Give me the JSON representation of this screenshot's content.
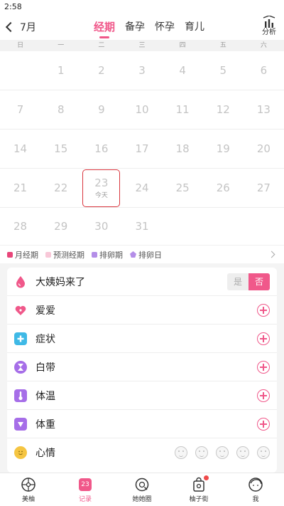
{
  "status_bar": {
    "time": "2:58"
  },
  "header": {
    "back_label": "7月",
    "tabs": [
      {
        "label": "经期",
        "active": true
      },
      {
        "label": "备孕",
        "active": false
      },
      {
        "label": "怀孕",
        "active": false
      },
      {
        "label": "育儿",
        "active": false
      }
    ],
    "analysis_label": "分析"
  },
  "calendar": {
    "weekdays": [
      "日",
      "一",
      "二",
      "三",
      "四",
      "五",
      "六"
    ],
    "rows": [
      [
        "",
        "1",
        "2",
        "3",
        "4",
        "5",
        "6"
      ],
      [
        "7",
        "8",
        "9",
        "10",
        "11",
        "12",
        "13"
      ],
      [
        "14",
        "15",
        "16",
        "17",
        "18",
        "19",
        "20"
      ],
      [
        "21",
        "22",
        "23",
        "24",
        "25",
        "26",
        "27"
      ],
      [
        "28",
        "29",
        "30",
        "31",
        "",
        "",
        ""
      ]
    ],
    "today_label": "今天"
  },
  "legend": {
    "items": [
      {
        "label": "月经期",
        "color": "#e8467a"
      },
      {
        "label": "预测经期",
        "color": "#f8c8d8"
      },
      {
        "label": "排卵期",
        "color": "#b48ee8"
      },
      {
        "label": "排卵日",
        "color": "#b48ee8"
      }
    ]
  },
  "record": {
    "period": {
      "label": "大姨妈来了",
      "yes_label": "是",
      "no_label": "否",
      "selected": "否"
    },
    "items": [
      {
        "label": "爱爱",
        "icon": "heart-icon",
        "color": "#f0588a"
      },
      {
        "label": "症状",
        "icon": "medkit-icon",
        "color": "#3fb9e6"
      },
      {
        "label": "白带",
        "icon": "hourglass-icon",
        "color": "#a66ee8"
      },
      {
        "label": "体温",
        "icon": "thermometer-icon",
        "color": "#a66ee8"
      },
      {
        "label": "体重",
        "icon": "scale-icon",
        "color": "#a66ee8"
      }
    ],
    "mood": {
      "label": "心情"
    }
  },
  "bottom_nav": {
    "items": [
      {
        "label": "美柚"
      },
      {
        "label": "记录",
        "badge": "23"
      },
      {
        "label": "她她圈"
      },
      {
        "label": "柚子街"
      },
      {
        "label": "我"
      }
    ]
  },
  "colors": {
    "accent": "#f0588a",
    "today_border": "#d9363e"
  }
}
